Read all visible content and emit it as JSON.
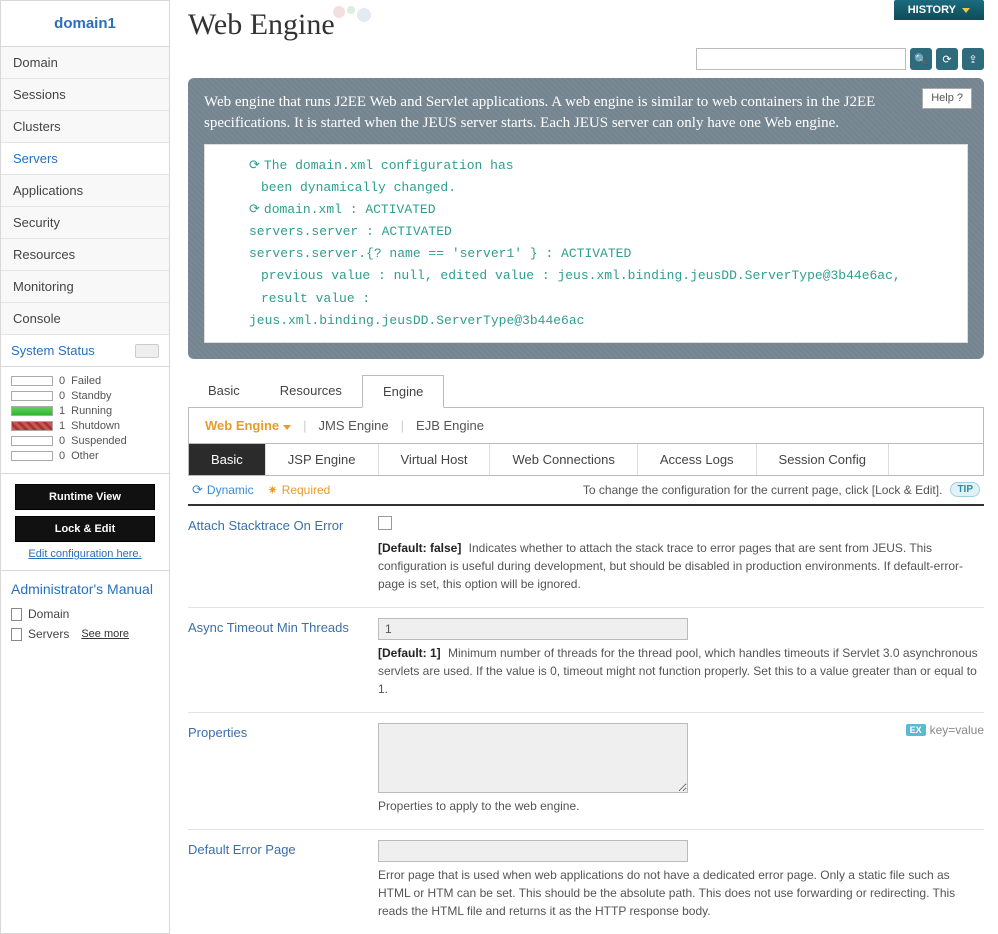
{
  "sidebar": {
    "title": "domain1",
    "nav": [
      "Domain",
      "Sessions",
      "Clusters",
      "Servers",
      "Applications",
      "Security",
      "Resources",
      "Monitoring",
      "Console"
    ],
    "active_idx": 3,
    "status_header": "System Status",
    "status": [
      {
        "count": 0,
        "label": "Failed",
        "bar": ""
      },
      {
        "count": 0,
        "label": "Standby",
        "bar": ""
      },
      {
        "count": 1,
        "label": "Running",
        "bar": "green"
      },
      {
        "count": 1,
        "label": "Shutdown",
        "bar": "red"
      },
      {
        "count": 0,
        "label": "Suspended",
        "bar": ""
      },
      {
        "count": 0,
        "label": "Other",
        "bar": ""
      }
    ],
    "buttons": {
      "runtime": "Runtime View",
      "lockedit": "Lock & Edit"
    },
    "edit_link": "Edit configuration here.",
    "manual_header": "Administrator's Manual",
    "manual_items": [
      "Domain",
      "Servers"
    ],
    "see_more": "See more"
  },
  "main": {
    "title": "Web Engine",
    "history": "HISTORY",
    "search_placeholder": "",
    "help_label": "Help  ?",
    "description": "Web engine that runs J2EE Web and Servlet applications. A web engine is similar to web containers in the J2EE specifications. It is started when the JEUS server starts. Each JEUS server can only have one Web engine.",
    "log_lines": [
      {
        "icon": true,
        "indent": 0,
        "text": "The domain.xml configuration has"
      },
      {
        "icon": false,
        "indent": 1,
        "text": "been dynamically changed."
      },
      {
        "icon": true,
        "indent": 0,
        "text": "domain.xml : ACTIVATED"
      },
      {
        "icon": false,
        "indent": 0,
        "text": "servers.server : ACTIVATED"
      },
      {
        "icon": false,
        "indent": 0,
        "text": "servers.server.{? name == 'server1' } : ACTIVATED"
      },
      {
        "icon": false,
        "indent": 1,
        "text": "previous value : null, edited value : jeus.xml.binding.jeusDD.ServerType@3b44e6ac, result value :"
      },
      {
        "icon": false,
        "indent": 0,
        "text": "jeus.xml.binding.jeusDD.ServerType@3b44e6ac"
      }
    ],
    "tabs1": [
      "Basic",
      "Resources",
      "Engine"
    ],
    "tabs1_active": 2,
    "tabs2": [
      "Web Engine",
      "JMS Engine",
      "EJB Engine"
    ],
    "tabs2_active": 0,
    "tabs3": [
      "Basic",
      "JSP Engine",
      "Virtual Host",
      "Web Connections",
      "Access Logs",
      "Session Config"
    ],
    "tabs3_active": 0,
    "legend": {
      "dynamic": "Dynamic",
      "required": "Required",
      "hint": "To change the configuration for the current page, click [Lock & Edit].",
      "tip": "TIP"
    },
    "kv_hint": "key=value",
    "fields": [
      {
        "label": "Attach Stacktrace On Error",
        "type": "checkbox",
        "default": "[Default: false]",
        "desc": "Indicates whether to attach the stack trace to error pages that are sent from JEUS. This configuration is useful during development, but should be disabled in production environments. If default-error-page is set, this option will be ignored."
      },
      {
        "label": "Async Timeout Min Threads",
        "type": "text",
        "value": "1",
        "default": "[Default: 1]",
        "desc": "Minimum number of threads for the thread pool, which handles timeouts if Servlet 3.0 asynchronous servlets are used. If the value is 0, timeout might not function properly. Set this to a value greater than or equal to 1."
      },
      {
        "label": "Properties",
        "type": "textarea",
        "value": "",
        "desc": "Properties to apply to the web engine.",
        "kv": true
      },
      {
        "label": "Default Error Page",
        "type": "text",
        "value": "",
        "desc": "Error page that is used when web applications do not have a dedicated error page. Only a static file such as HTML or HTM can be set. This should be the absolute path. This does not use forwarding or redirecting. This reads the HTML file and returns it as the HTTP response body."
      }
    ]
  }
}
